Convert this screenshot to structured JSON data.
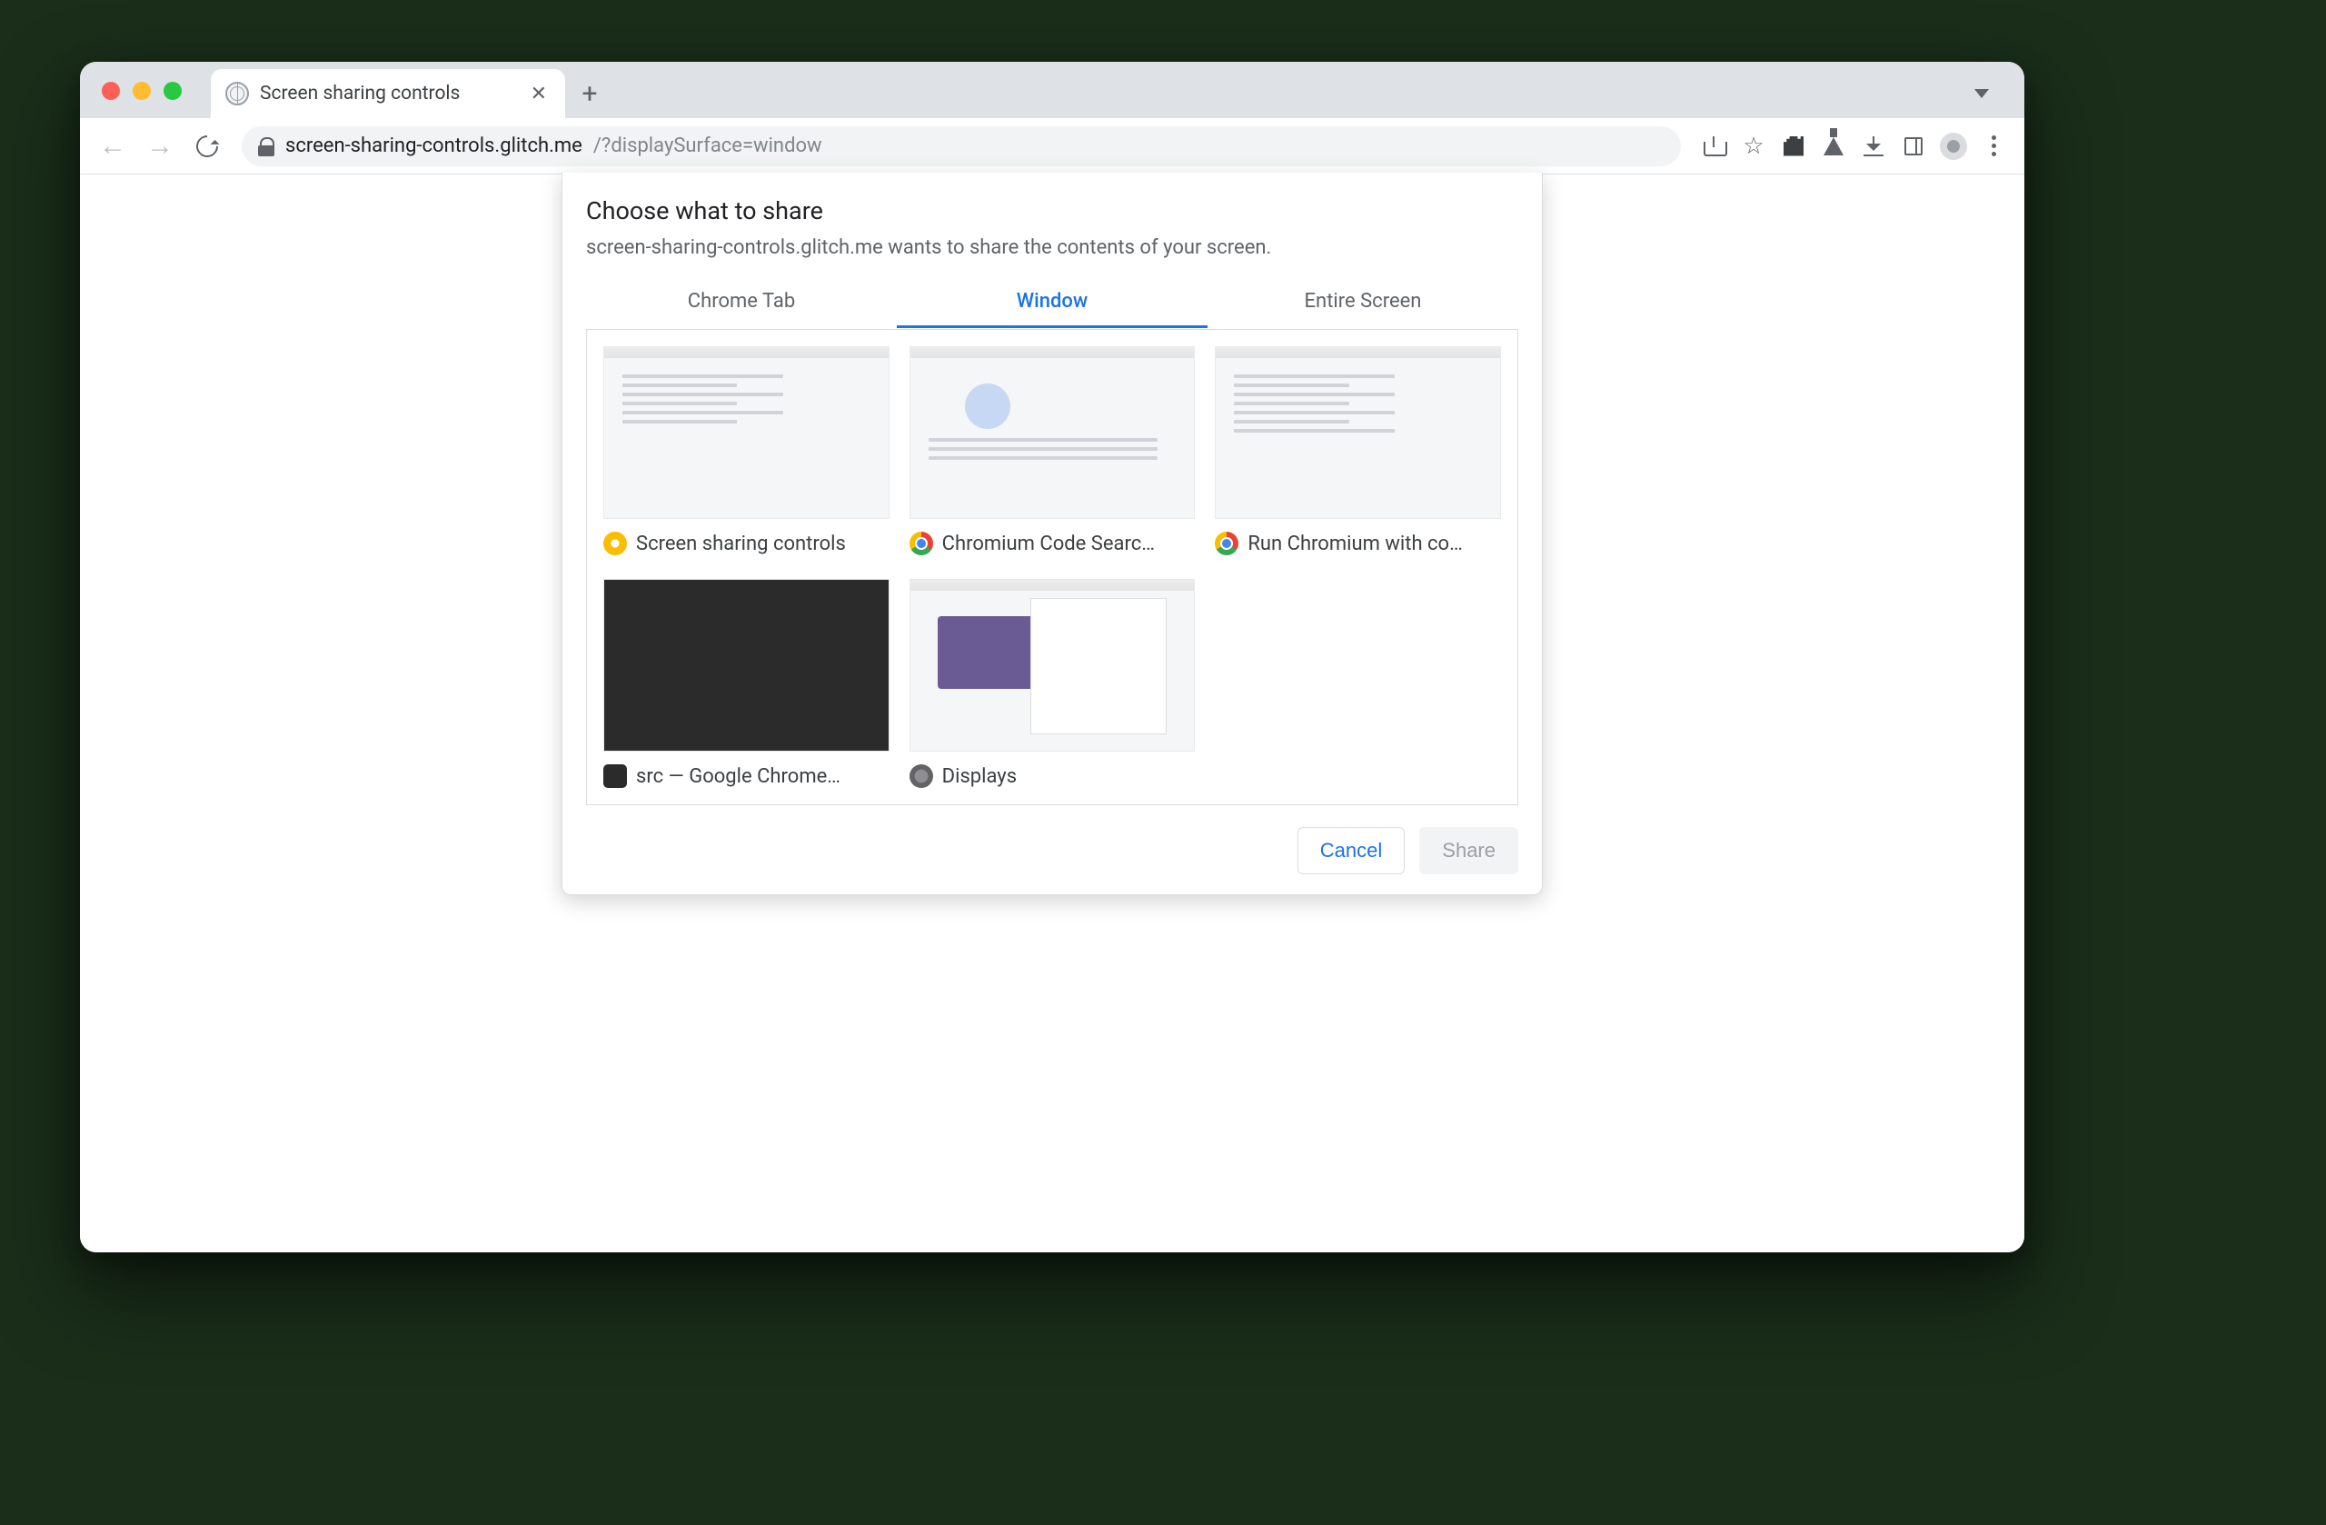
{
  "window": {
    "traffic": [
      "close",
      "minimize",
      "maximize"
    ]
  },
  "tab": {
    "title": "Screen sharing controls"
  },
  "address": {
    "host": "screen-sharing-controls.glitch.me",
    "path": "/?displaySurface=window"
  },
  "dialog": {
    "title": "Choose what to share",
    "subtitle": "screen-sharing-controls.glitch.me wants to share the contents of your screen.",
    "tabs": [
      {
        "label": "Chrome Tab",
        "active": false
      },
      {
        "label": "Window",
        "active": true
      },
      {
        "label": "Entire Screen",
        "active": false
      }
    ],
    "windows": [
      {
        "label": "Screen sharing controls",
        "icon": "canary"
      },
      {
        "label": "Chromium Code Searc…",
        "icon": "chrome"
      },
      {
        "label": "Run Chromium with co…",
        "icon": "chrome"
      },
      {
        "label": "src — Google Chrome…",
        "icon": "term"
      },
      {
        "label": "Displays",
        "icon": "sys"
      }
    ],
    "actions": {
      "cancel": "Cancel",
      "share": "Share"
    }
  }
}
